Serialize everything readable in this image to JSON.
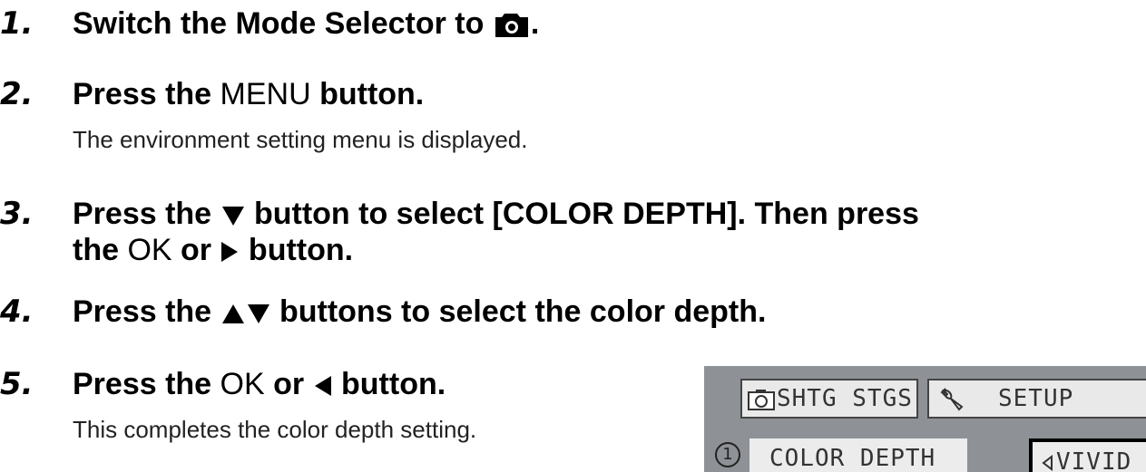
{
  "steps": [
    {
      "number": "1.",
      "parts": [
        "Switch the Mode Selector to ",
        "."
      ],
      "icon": "camera-icon"
    },
    {
      "number": "2.",
      "pre": "Press the ",
      "key": "MENU",
      "post": " button.",
      "description": "The environment setting menu is displayed."
    },
    {
      "number": "3.",
      "line1_pre": "Press the ",
      "line1_icon": "down-triangle-icon",
      "line1_post": " button to select [COLOR DEPTH]. Then press",
      "line2_pre": "the ",
      "line2_key": "OK",
      "line2_mid": " or ",
      "line2_icon": "right-triangle-icon",
      "line2_post": " button."
    },
    {
      "number": "4.",
      "pre": "Press the ",
      "icon": "up-down-triangles-icon",
      "post": " buttons to select the color depth."
    },
    {
      "number": "5.",
      "pre": "Press the ",
      "key": "OK",
      "mid": " or ",
      "icon": "left-triangle-icon",
      "post": " button.",
      "description": "This completes the color depth setting."
    }
  ],
  "screen": {
    "tab1_label": "SHTG STGS",
    "tab2_label": "SETUP",
    "circle_number": "1",
    "row_label": "COLOR DEPTH",
    "row_value": "VIVID"
  }
}
